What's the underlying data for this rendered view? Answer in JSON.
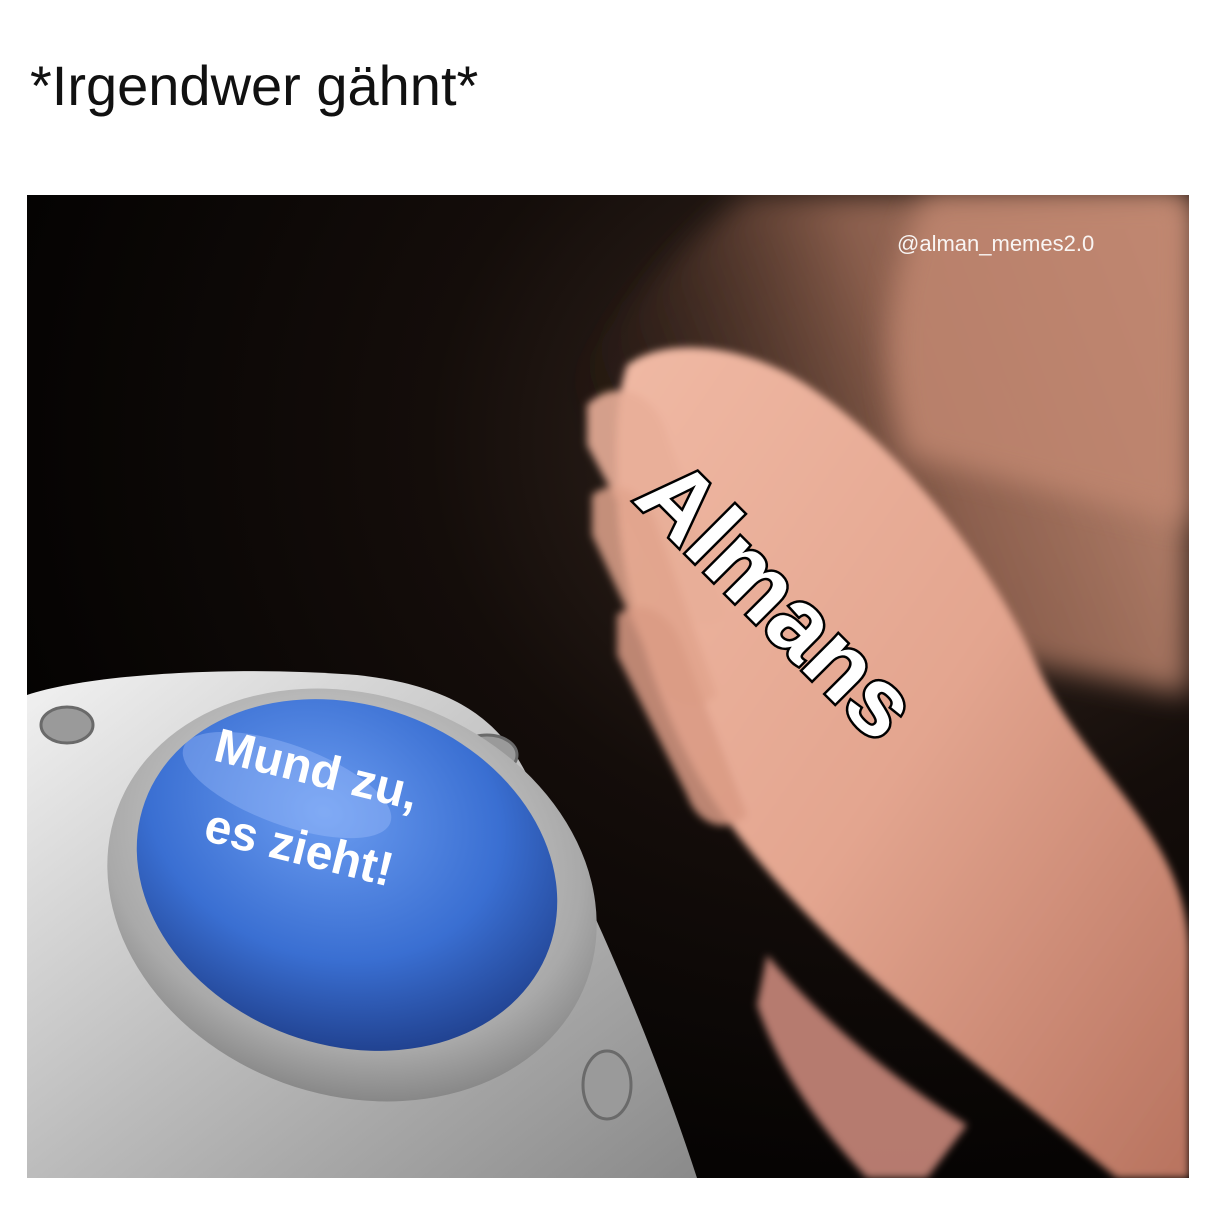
{
  "caption": "*Irgendwer gähnt*",
  "image": {
    "watermark": "@alman_memes2.0",
    "hand_label": "Almans",
    "button_label_line1": "Mund zu,",
    "button_label_line2": "es zieht!"
  },
  "colors": {
    "page_background": "#ffffff",
    "button_blue": "#3a6fd2",
    "skin": "#d99a84",
    "metal": "#cfcfcf",
    "background_dark": "#000000"
  }
}
